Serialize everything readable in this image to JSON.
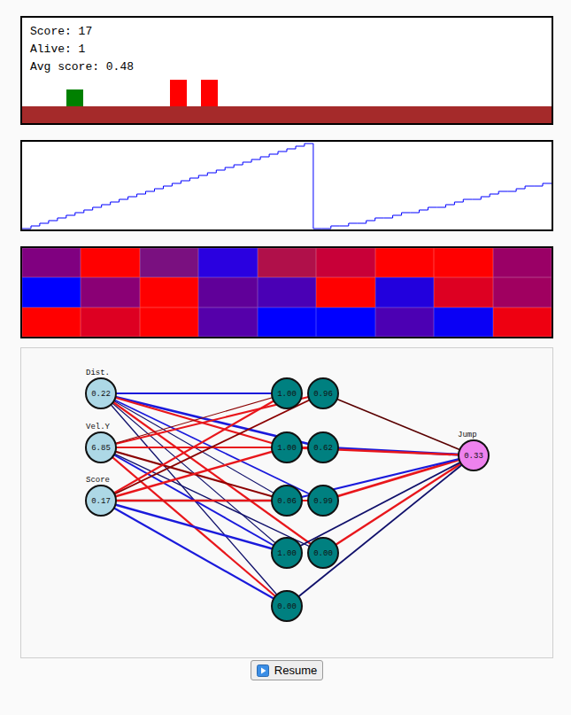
{
  "game": {
    "score": "Score: 17",
    "alive": "Alive: 1",
    "avg_score": "Avg score: 0.48",
    "player": {
      "color": "#008000"
    },
    "obstacles": [
      {
        "color": "#ff0000"
      },
      {
        "color": "#ff0000"
      }
    ],
    "ground": {
      "color": "#a52a2a"
    }
  },
  "score_chart": {
    "series": [
      {
        "color": "#0000ff",
        "values": [
          0,
          1,
          2,
          3,
          4,
          5,
          6,
          7,
          8,
          9,
          10,
          11,
          12,
          13,
          14,
          15,
          16,
          17,
          18,
          19,
          20,
          21,
          22,
          23,
          24,
          25,
          26,
          27,
          28,
          29,
          30,
          31,
          32,
          0,
          0,
          1,
          1,
          2,
          2,
          3,
          4,
          4,
          5,
          6,
          6,
          7,
          8,
          8,
          9,
          10,
          11,
          11,
          12,
          13,
          14,
          14,
          15,
          16,
          16,
          17
        ]
      }
    ]
  },
  "weights_grid": {
    "rows": [
      [
        {
          "color": "#800080"
        },
        {
          "color": "#ff0000"
        },
        {
          "color": "#7a1080"
        },
        {
          "color": "#2a00e0"
        },
        {
          "color": "#b0104a"
        },
        {
          "color": "#c80038"
        },
        {
          "color": "#ff0000"
        },
        {
          "color": "#ff0000"
        },
        {
          "color": "#9a0066"
        }
      ],
      [
        {
          "color": "#0000ff"
        },
        {
          "color": "#8a0075"
        },
        {
          "color": "#ff0000"
        },
        {
          "color": "#600099"
        },
        {
          "color": "#4a00b5"
        },
        {
          "color": "#ff0000"
        },
        {
          "color": "#2200dd"
        },
        {
          "color": "#dd0022"
        },
        {
          "color": "#a00060"
        }
      ],
      [
        {
          "color": "#ff0000"
        },
        {
          "color": "#dd0022"
        },
        {
          "color": "#ff0000"
        },
        {
          "color": "#5500aa"
        },
        {
          "color": "#0000ff"
        },
        {
          "color": "#0000ff"
        },
        {
          "color": "#4c00b3"
        },
        {
          "color": "#0a00f5"
        },
        {
          "color": "#ee0011"
        }
      ]
    ]
  },
  "network": {
    "layers": [
      {
        "nodes": [
          {
            "label": "Dist.",
            "value": "0.22"
          },
          {
            "label": "Vel.Y",
            "value": "6.85"
          },
          {
            "label": "Score",
            "value": "0.17"
          }
        ]
      },
      {
        "nodes": [
          {
            "label": "",
            "value": "1.00"
          },
          {
            "label": "",
            "value": "1.00"
          },
          {
            "label": "",
            "value": "0.06"
          },
          {
            "label": "",
            "value": "1.00"
          },
          {
            "label": "",
            "value": "0.00"
          }
        ]
      },
      {
        "nodes": [
          {
            "label": "",
            "value": "0.96"
          },
          {
            "label": "",
            "value": "0.62"
          },
          {
            "label": "",
            "value": "0.99"
          },
          {
            "label": "",
            "value": "0.00"
          }
        ]
      },
      {
        "nodes": [
          {
            "label": "Jump",
            "value": "0.33"
          }
        ]
      }
    ],
    "edges": [
      {
        "from": [
          0,
          0
        ],
        "to": [
          1,
          0
        ],
        "color": "#1a1adb",
        "level": 0.6
      },
      {
        "from": [
          0,
          0
        ],
        "to": [
          2,
          1
        ],
        "color": "#1a1adb",
        "level": 0.8
      },
      {
        "from": [
          0,
          0
        ],
        "to": [
          1,
          1
        ],
        "color": "#e8161b",
        "level": 0.6
      },
      {
        "from": [
          0,
          0
        ],
        "to": [
          1,
          2
        ],
        "color": "#10106b",
        "level": 0.2
      },
      {
        "from": [
          0,
          0
        ],
        "to": [
          1,
          3
        ],
        "color": "#10106b",
        "level": 0.2
      },
      {
        "from": [
          0,
          0
        ],
        "to": [
          1,
          4
        ],
        "color": "#10106b",
        "level": 0.3
      },
      {
        "from": [
          0,
          0
        ],
        "to": [
          2,
          3
        ],
        "color": "#e8161b",
        "level": 0.6
      },
      {
        "from": [
          0,
          0
        ],
        "to": [
          2,
          2
        ],
        "color": "#1a1adb",
        "level": 0.4
      },
      {
        "from": [
          0,
          1
        ],
        "to": [
          2,
          0
        ],
        "color": "#e8161b",
        "level": 0.6
      },
      {
        "from": [
          0,
          1
        ],
        "to": [
          1,
          0
        ],
        "color": "#8b0000",
        "level": 0.2
      },
      {
        "from": [
          0,
          1
        ],
        "to": [
          1,
          1
        ],
        "color": "#8b0000",
        "level": 0.6
      },
      {
        "from": [
          0,
          1
        ],
        "to": [
          1,
          2
        ],
        "color": "#8b0000",
        "level": 0.6
      },
      {
        "from": [
          0,
          1
        ],
        "to": [
          1,
          3
        ],
        "color": "#1a1adb",
        "level": 0.5
      },
      {
        "from": [
          0,
          1
        ],
        "to": [
          2,
          3
        ],
        "color": "#10106b",
        "level": 0.3
      },
      {
        "from": [
          0,
          1
        ],
        "to": [
          1,
          4
        ],
        "color": "#e8161b",
        "level": 0.6
      },
      {
        "from": [
          0,
          1
        ],
        "to": [
          2,
          1
        ],
        "color": "#e8161b",
        "level": 0.5
      },
      {
        "from": [
          0,
          2
        ],
        "to": [
          1,
          0
        ],
        "color": "#e8161b",
        "level": 0.6
      },
      {
        "from": [
          0,
          2
        ],
        "to": [
          2,
          0
        ],
        "color": "#8b0000",
        "level": 0.5
      },
      {
        "from": [
          0,
          2
        ],
        "to": [
          1,
          1
        ],
        "color": "#e8161b",
        "level": 0.7
      },
      {
        "from": [
          0,
          2
        ],
        "to": [
          1,
          2
        ],
        "color": "#8b0000",
        "level": 0.7
      },
      {
        "from": [
          0,
          2
        ],
        "to": [
          2,
          2
        ],
        "color": "#e8161b",
        "level": 0.6
      },
      {
        "from": [
          0,
          2
        ],
        "to": [
          1,
          3
        ],
        "color": "#1a1adb",
        "level": 0.7
      },
      {
        "from": [
          0,
          2
        ],
        "to": [
          1,
          4
        ],
        "color": "#1a1adb",
        "level": 0.6
      },
      {
        "from": [
          2,
          0
        ],
        "to": [
          3,
          0
        ],
        "color": "#5a0000",
        "level": 0.4
      },
      {
        "from": [
          2,
          1
        ],
        "to": [
          3,
          0
        ],
        "color": "#1a1adb",
        "level": 0.9
      },
      {
        "from": [
          1,
          1
        ],
        "to": [
          3,
          0
        ],
        "color": "#e8161b",
        "level": 0.7
      },
      {
        "from": [
          2,
          2
        ],
        "to": [
          3,
          0
        ],
        "color": "#e8161b",
        "level": 0.8
      },
      {
        "from": [
          1,
          2
        ],
        "to": [
          3,
          0
        ],
        "color": "#1a1adb",
        "level": 0.6
      },
      {
        "from": [
          2,
          3
        ],
        "to": [
          3,
          0
        ],
        "color": "#e8161b",
        "level": 0.7
      },
      {
        "from": [
          1,
          3
        ],
        "to": [
          3,
          0
        ],
        "color": "#10106b",
        "level": 0.5
      },
      {
        "from": [
          1,
          4
        ],
        "to": [
          3,
          0
        ],
        "color": "#10106b",
        "level": 0.5
      }
    ]
  },
  "button": {
    "label": "Resume"
  }
}
